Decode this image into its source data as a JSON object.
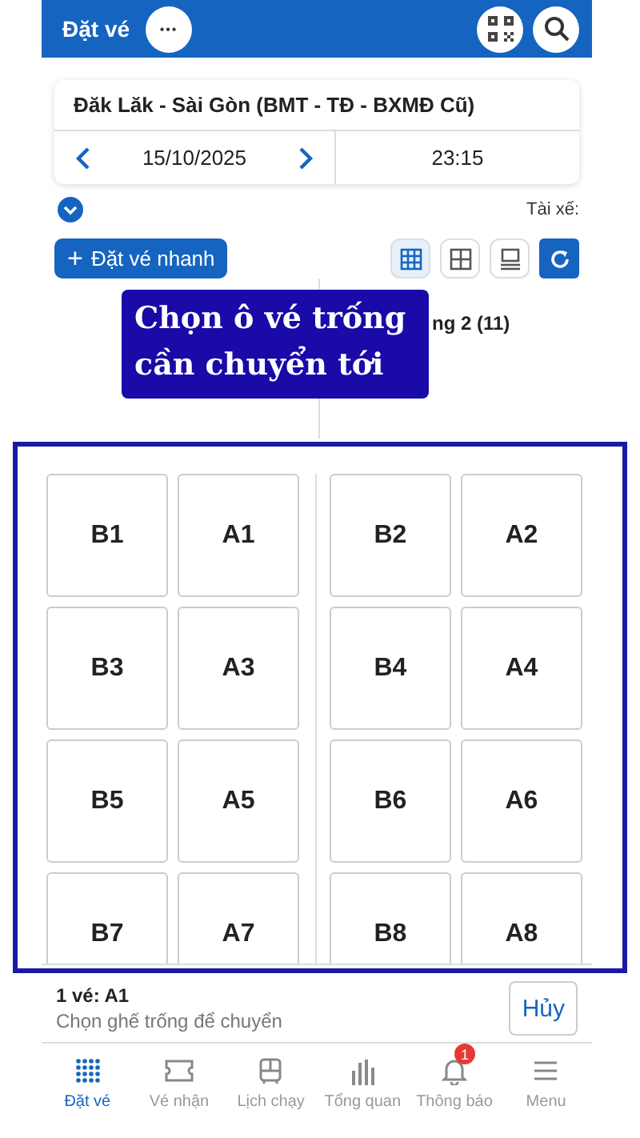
{
  "header": {
    "title": "Đặt vé",
    "more": "•••"
  },
  "route": {
    "name": "Đăk Lăk - Sài Gòn (BMT - TĐ - BXMĐ Cũ)",
    "date": "15/10/2025",
    "time": "23:15"
  },
  "driver_label": "Tài xế:",
  "quick_book": {
    "plus": "+",
    "label": "Đặt vé nhanh"
  },
  "view_modes": [
    {
      "kind": "grid9",
      "selected": true
    },
    {
      "kind": "grid4",
      "selected": false
    },
    {
      "kind": "list",
      "selected": false
    }
  ],
  "floor_label": "ng 2 (11)",
  "callout": "Chọn ô vé trống cần chuyển tới",
  "seat_halves": [
    {
      "seats": [
        "B1",
        "A1",
        "B3",
        "A3",
        "B5",
        "A5",
        "B7",
        "A7"
      ]
    },
    {
      "seats": [
        "B2",
        "A2",
        "B4",
        "A4",
        "B6",
        "A6",
        "B8",
        "A8"
      ]
    }
  ],
  "selection": {
    "count": "1 vé: A1",
    "hint": "Chọn ghế trống để chuyển",
    "cancel": "Hủy"
  },
  "nav": [
    {
      "kind": "dots",
      "label": "Đặt vé",
      "selected": true
    },
    {
      "kind": "ticket",
      "label": "Vé nhận",
      "selected": false
    },
    {
      "kind": "bus",
      "label": "Lịch chạy",
      "selected": false
    },
    {
      "kind": "chart",
      "label": "Tổng quan",
      "selected": false
    },
    {
      "kind": "bell",
      "label": "Thông báo",
      "selected": false,
      "badge": "1"
    },
    {
      "kind": "menu",
      "label": "Menu",
      "selected": false
    }
  ]
}
